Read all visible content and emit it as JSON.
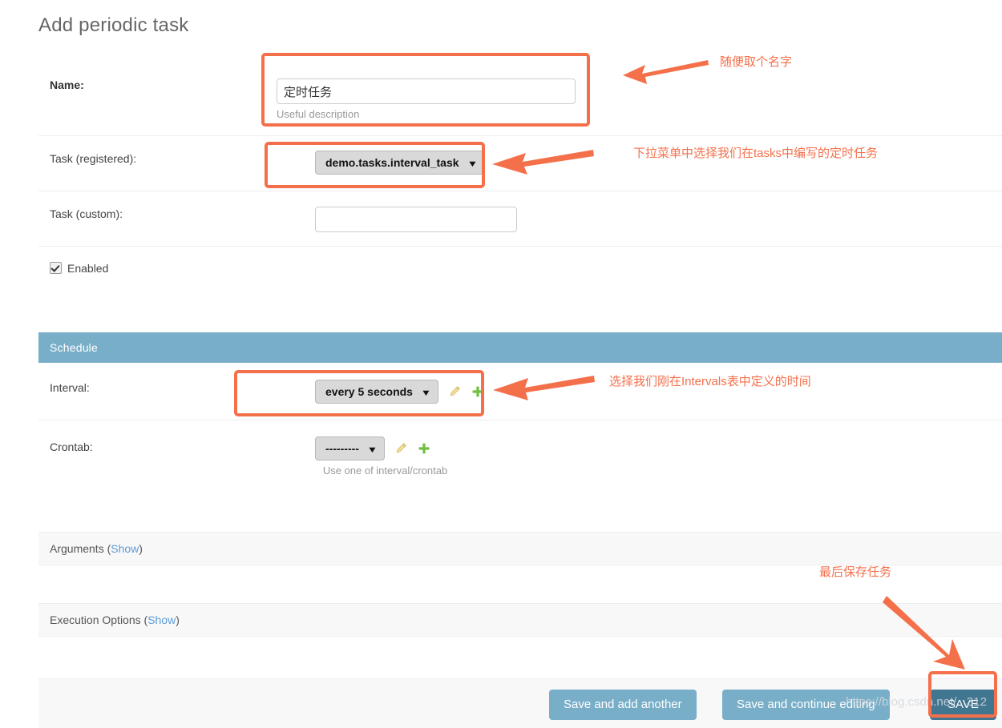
{
  "page": {
    "title": "Add periodic task"
  },
  "form": {
    "rows": [
      {
        "label": "Name:",
        "value": "定时任务",
        "help": "Useful description"
      },
      {
        "label": "Task (registered):",
        "value": "demo.tasks.interval_task"
      },
      {
        "label": "Task (custom):",
        "value": ""
      },
      {
        "label": "Enabled"
      }
    ]
  },
  "schedule": {
    "header": "Schedule",
    "interval": {
      "label": "Interval:",
      "value": "every 5 seconds",
      "edit_icon": "pencil-icon",
      "add_icon": "plus-icon"
    },
    "crontab": {
      "label": "Crontab:",
      "value": "---------",
      "help": "Use one of interval/crontab",
      "edit_icon": "pencil-icon",
      "add_icon": "plus-icon"
    }
  },
  "collapsibles": [
    {
      "title": "Arguments",
      "toggle": "Show"
    },
    {
      "title": "Execution Options",
      "toggle": "Show"
    }
  ],
  "submit": {
    "save_and_add_another": "Save and add another",
    "save_and_continue": "Save and continue editing",
    "save": "SAVE"
  },
  "annotations": [
    {
      "text": "随便取个名字"
    },
    {
      "text": "下拉菜单中选择我们在tasks中编写的定时任务"
    },
    {
      "text": "选择我们刚在Intervals表中定义的时间"
    },
    {
      "text": "最后保存任务"
    }
  ],
  "watermark": {
    "text": "https://blog.csdn.net/...312"
  },
  "colors": {
    "accent_orange": "#f4704b",
    "header_blue": "#79aec8",
    "primary_blue": "#417690",
    "link_blue": "#5b9dd9",
    "plus_green": "#70bf41"
  }
}
